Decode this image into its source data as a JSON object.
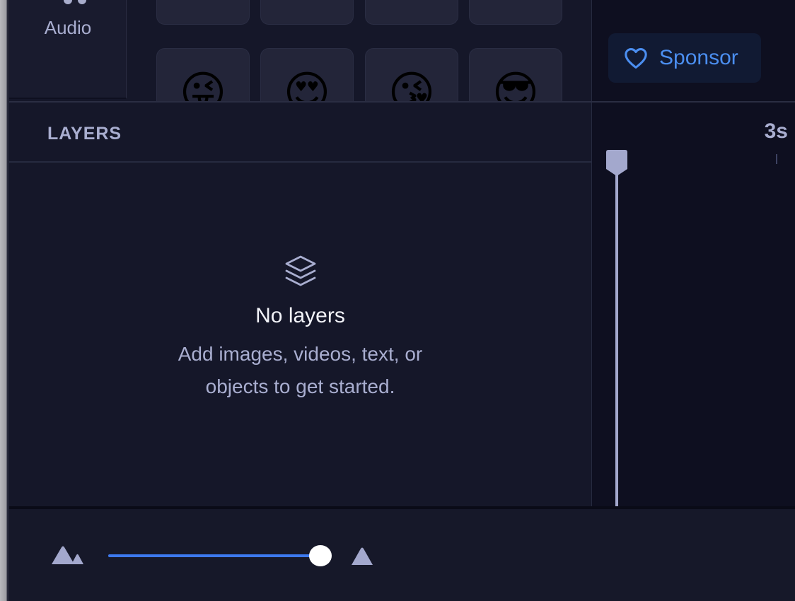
{
  "sidebar": {
    "audio_tab": {
      "label": "Audio",
      "icon": "music-note-icon"
    }
  },
  "emoji_grid": {
    "row1": [
      "",
      "",
      "",
      "😀"
    ],
    "row2": [
      "😜",
      "😍",
      "😘",
      "😎"
    ]
  },
  "header": {
    "sponsor": {
      "label": "Sponsor",
      "icon": "heart-icon",
      "color": "#4b8ef0"
    }
  },
  "layers": {
    "title": "LAYERS",
    "empty_state": {
      "icon": "layers-stack-icon",
      "title": "No layers",
      "description": "Add images, videos, text, or objects to get started."
    }
  },
  "timeline": {
    "time_label": "3s"
  },
  "zoom": {
    "zoom_out_icon": "mountains-icon",
    "zoom_in_icon": "triangle-icon",
    "level": 1.0,
    "accent": "#3d79ee"
  }
}
